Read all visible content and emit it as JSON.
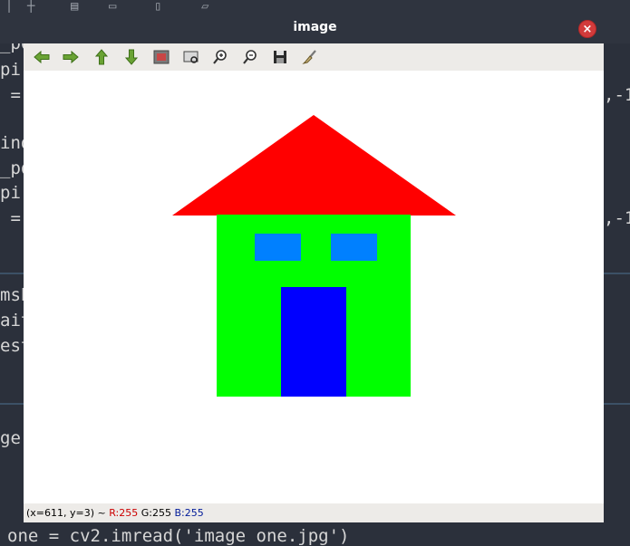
{
  "window": {
    "title": "image",
    "close_label": "×"
  },
  "toolbar": {
    "tools": [
      {
        "name": "pan-left-icon"
      },
      {
        "name": "pan-right-icon"
      },
      {
        "name": "pan-up-icon"
      },
      {
        "name": "pan-down-icon"
      },
      {
        "name": "zoom-original-icon"
      },
      {
        "name": "zoom-fit-icon"
      },
      {
        "name": "zoom-in-icon"
      },
      {
        "name": "zoom-out-icon"
      },
      {
        "name": "save-icon"
      },
      {
        "name": "properties-icon"
      }
    ]
  },
  "image": {
    "roof_color": "#ff0000",
    "wall_color": "#00ff00",
    "window_color": "#0080ff",
    "door_color": "#0000ff",
    "background_color": "#ffffff"
  },
  "status": {
    "coords": "(x=611, y=3) ~",
    "r": "R:255",
    "g": "G:255",
    "b": "B:255"
  },
  "editor": {
    "lines": [
      "_po",
      "pir",
      " =",
      "ind",
      "_po",
      "pir",
      " =",
      "msh",
      "ait",
      "est",
      "ge",
      ",-1",
      ",-1"
    ],
    "bottom_line": "one = cv2.imread('image one.jpg')"
  }
}
